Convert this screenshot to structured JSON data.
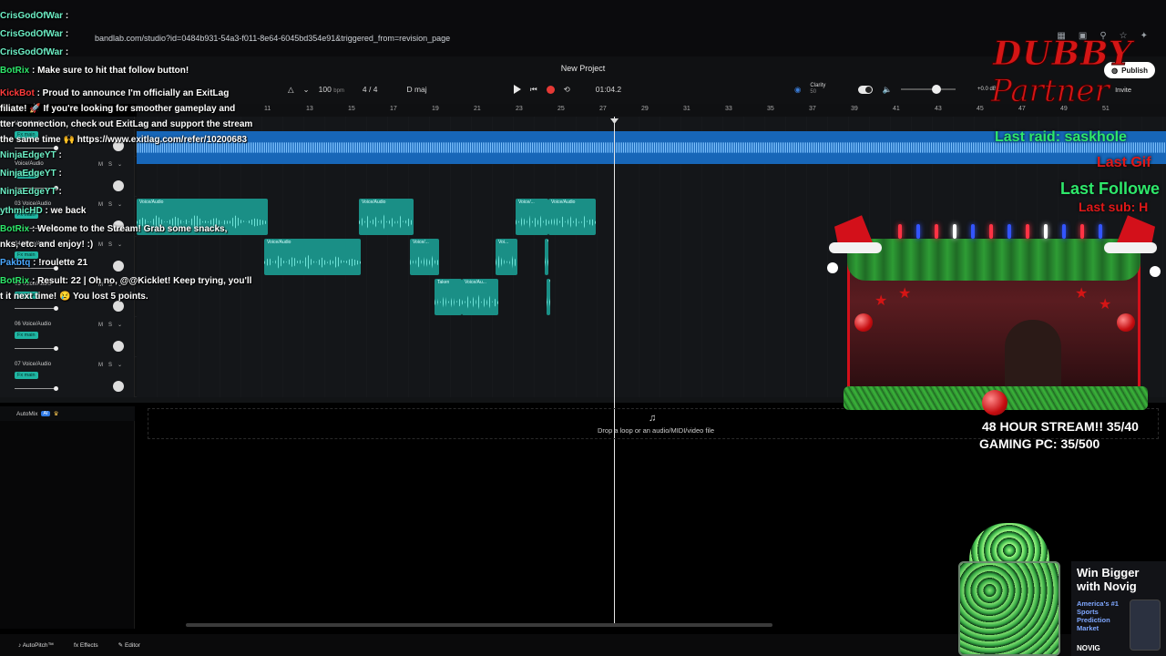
{
  "browser": {
    "url": "bandlab.com/studio?id=0484b931-54a3-f011-8e64-6045bd354e91&triggered_from=revision_page"
  },
  "studio": {
    "project_title": "New Project",
    "tempo": "100",
    "tempo_unit": "bpm",
    "time_signature": "4 / 4",
    "key": "D maj",
    "time_display": "01:04.2",
    "clarity_label": "Clarity",
    "clarity_value": "50",
    "gain": "+0.0 dB",
    "publish_label": "Publish",
    "invite_label": "Invite"
  },
  "ruler": [
    "11",
    "13",
    "15",
    "17",
    "19",
    "21",
    "23",
    "25",
    "27",
    "29",
    "31",
    "33",
    "35",
    "37",
    "39",
    "41",
    "43",
    "45",
    "47",
    "49",
    "51"
  ],
  "tracks": [
    {
      "name": "Voice/Audio",
      "fx": "Fx main"
    },
    {
      "name": "Voice/Audio",
      "fx": "Fx main"
    },
    {
      "name": "03  Voice/Audio",
      "fx": "Fx main"
    },
    {
      "name": "04  Voice/Audio",
      "fx": "Fx main"
    },
    {
      "name": "05  Voice/Audio",
      "fx": "Fx main"
    },
    {
      "name": "06  Voice/Audio",
      "fx": "Fx main"
    },
    {
      "name": "07  Voice/Audio",
      "fx": "Fx main"
    }
  ],
  "clips": {
    "voice_audio": "Voice/Audio",
    "voice_short": "Voice/...",
    "voi": "Voi...",
    "take": "Taken",
    "voice_au": "Voice/Au..."
  },
  "automix": {
    "label": "AutoMix",
    "badge": "AI"
  },
  "drop_text": "Drop a loop or an audio/MIDI/video file",
  "bottom_bar": {
    "autopitch": "AutoPitch™",
    "effects": "Effects",
    "editor": "Editor"
  },
  "chat": [
    {
      "user": "CrisGodOfWar",
      "msg": ":"
    },
    {
      "user": "CrisGodOfWar",
      "msg": ":"
    },
    {
      "user": "CrisGodOfWar",
      "msg": ":"
    },
    {
      "user": "BotRix",
      "msg": ": Make sure to hit that follow button!"
    },
    {
      "user": "KickBot",
      "msg": ": Proud to announce I'm officially an ExitLag"
    },
    {
      "user": "",
      "msg": "filiate! 🚀 If you're looking for smoother gameplay and"
    },
    {
      "user": "",
      "msg": "tter connection, check out ExitLag and support the stream"
    },
    {
      "user": "",
      "msg": "the same time 🙌 https://www.exitlag.com/refer/10200683"
    },
    {
      "user": "NinjaEdgeYT",
      "msg": ":"
    },
    {
      "user": "NinjaEdgeYT",
      "msg": ":"
    },
    {
      "user": "NinjaEdgeYT",
      "msg": ":"
    },
    {
      "user": "ythmicHD",
      "msg": ": we back"
    },
    {
      "user": "BotRix",
      "msg": ": Welcome to the Stream! Grab some snacks,"
    },
    {
      "user": "",
      "msg": "nks, etc. and enjoy! :)"
    },
    {
      "user": "Pakbtq",
      "msg": ": !roulette 21"
    },
    {
      "user": "BotRix",
      "msg": ": Result: 22 | Oh no, @@Kicklet! Keep trying, you'll"
    },
    {
      "user": "",
      "msg": "t it next time! 😢 You lost 5 points."
    }
  ],
  "overlay": {
    "logo_line1": "DUBBY",
    "logo_line2": "Partner",
    "last_raid": "Last raid: saskhole",
    "last_gift": "Last Gif",
    "last_follower": "Last Followe",
    "last_sub": "Last sub: H",
    "stream_line1": "48 HOUR STREAM!! 35/40",
    "stream_line2": "GAMING PC: 35/500",
    "ad_title_1": "Win Bigger",
    "ad_title_2": "with Novig",
    "ad_sub": "America's #1 Sports Prediction Market",
    "ad_brand": "NOVIG"
  }
}
